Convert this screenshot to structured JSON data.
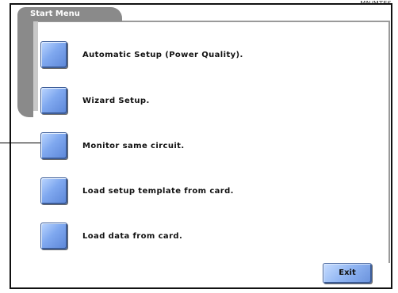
{
  "corner": {
    "text": "MN/MTES"
  },
  "menu": {
    "title": "Start Menu",
    "items": [
      {
        "label": "Automatic Setup (Power Quality)."
      },
      {
        "label": "Wizard Setup."
      },
      {
        "label": "Monitor same circuit."
      },
      {
        "label": "Load setup template from card."
      },
      {
        "label": "Load data from card."
      }
    ]
  },
  "footer": {
    "exit_label": "Exit"
  },
  "colors": {
    "button_blue": "#7fa8ef",
    "tab_gray": "#8a8a8a",
    "background": "#ffffff"
  },
  "icons": {
    "item_button": "blue-square-button"
  }
}
